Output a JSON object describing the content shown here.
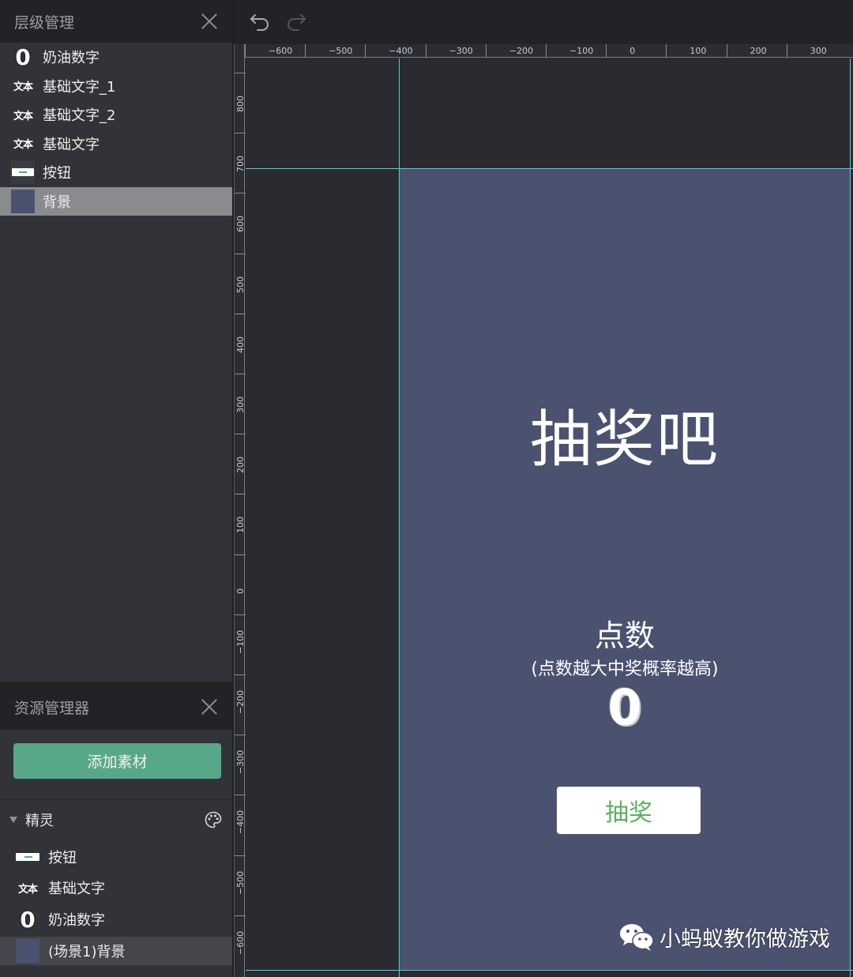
{
  "layers_panel": {
    "title": "层级管理",
    "items": [
      {
        "label": "奶油数字",
        "icon": "zero-digit-icon",
        "icon_text": "0"
      },
      {
        "label": "基础文字_1",
        "icon": "text-icon",
        "icon_text": "文本"
      },
      {
        "label": "基础文字_2",
        "icon": "text-icon",
        "icon_text": "文本"
      },
      {
        "label": "基础文字",
        "icon": "text-icon",
        "icon_text": "文本"
      },
      {
        "label": "按钮",
        "icon": "button-thumbnail-icon"
      },
      {
        "label": "背景",
        "icon": "background-thumbnail-icon",
        "selected": true
      }
    ]
  },
  "assets_panel": {
    "title": "资源管理器",
    "add_button": "添加素材",
    "sprites_section": "精灵",
    "items": [
      {
        "label": "按钮",
        "icon": "button-thumbnail-icon"
      },
      {
        "label": "基础文字",
        "icon": "text-icon",
        "icon_text": "文本"
      },
      {
        "label": "奶油数字",
        "icon": "zero-digit-icon",
        "icon_text": "0"
      },
      {
        "label": "(场景1)背景",
        "icon": "background-thumbnail-icon",
        "selected": true
      }
    ]
  },
  "ruler": {
    "x_labels": [
      "−600",
      "−500",
      "−400",
      "−300",
      "−200",
      "−100",
      "0",
      "100",
      "200",
      "300"
    ],
    "y_labels": [
      "800",
      "700",
      "600",
      "500",
      "400",
      "300",
      "200",
      "100",
      "0",
      "−100",
      "−200",
      "−300",
      "−400",
      "−500",
      "−600"
    ]
  },
  "stage": {
    "title": "抽奖吧",
    "points_label": "点数",
    "hint": "(点数越大中奖概率越高)",
    "score": "0",
    "draw_button": "抽奖",
    "background_color": "#4a5270"
  },
  "watermark": {
    "text": "小蚂蚁教你做游戏",
    "icon": "wechat-icon"
  },
  "colors": {
    "accent": "#57a888",
    "guide": "#4fd3d8",
    "button_text": "#5bb05f"
  }
}
